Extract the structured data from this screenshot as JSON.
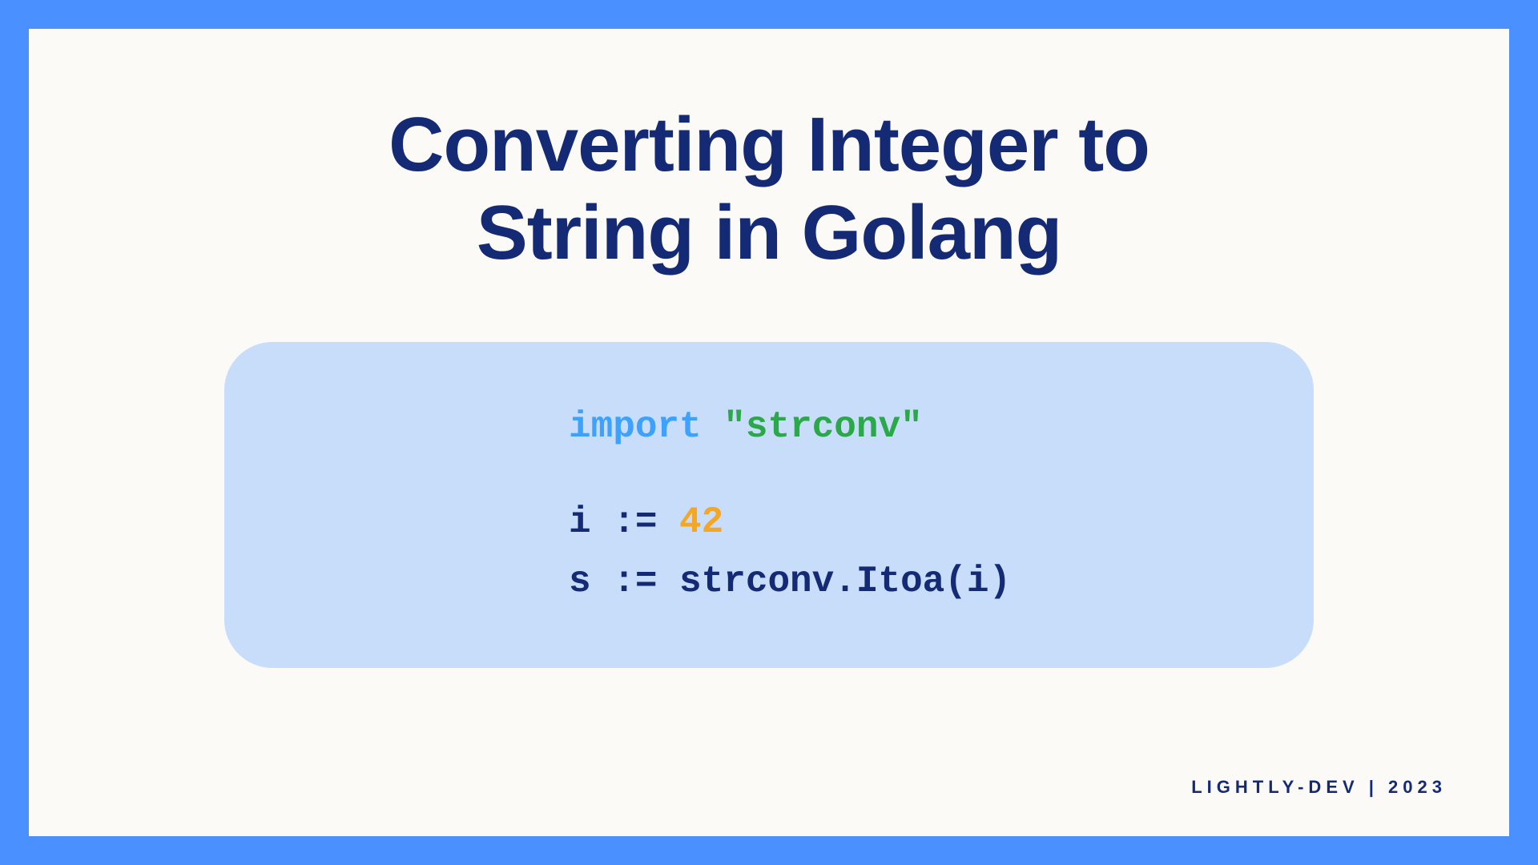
{
  "slide": {
    "title_line1": "Converting Integer to",
    "title_line2": "String in Golang"
  },
  "code": {
    "import_kw": "import",
    "import_pkg": "\"strconv\"",
    "line2_a": "i := ",
    "line2_num": "42",
    "line3": "s := strconv.Itoa(i)"
  },
  "footer": {
    "text": "LIGHTLY-DEV | 2023"
  }
}
